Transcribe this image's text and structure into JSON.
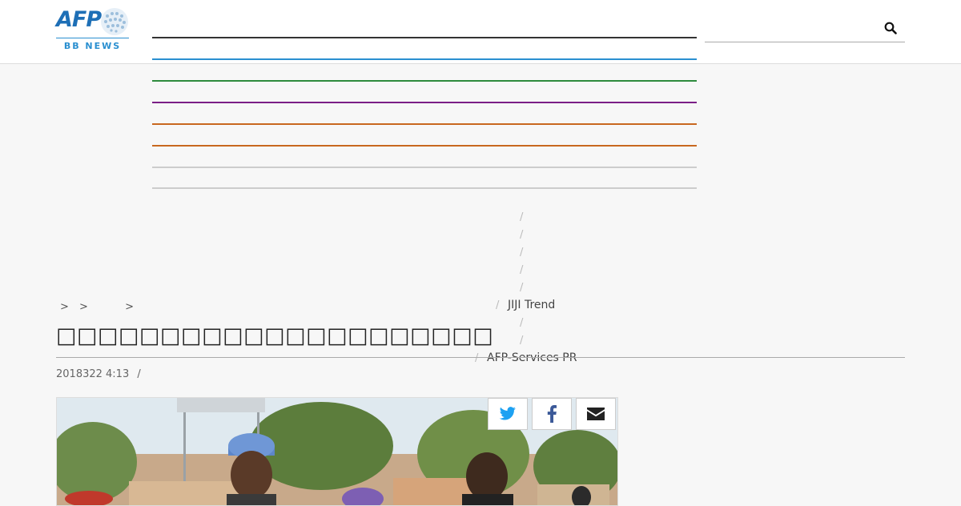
{
  "header": {
    "logo": {
      "brand": "AFP",
      "sub": "BB NEWS"
    },
    "search": {
      "placeholder": "",
      "icon": "search-icon"
    },
    "nav_line_colors": [
      "#333333",
      "#2a8fd0",
      "#2e8b3d",
      "#7b1f86",
      "#c8681f",
      "#c8681f",
      "#cccccc",
      "#cccccc"
    ]
  },
  "dropdown": {
    "items": [
      "",
      "",
      "",
      "",
      "",
      "JIJI Trend",
      "",
      "",
      "AFP-Services PR"
    ]
  },
  "breadcrumb": [
    ">",
    ">",
    ">"
  ],
  "article": {
    "title": "□□□□□□□□□□□□□□□□□□□□□",
    "date": "2018322 4:13",
    "date_separator": "/"
  },
  "share": {
    "twitter": "twitter-icon",
    "facebook": "facebook-icon",
    "email": "envelope-icon"
  }
}
